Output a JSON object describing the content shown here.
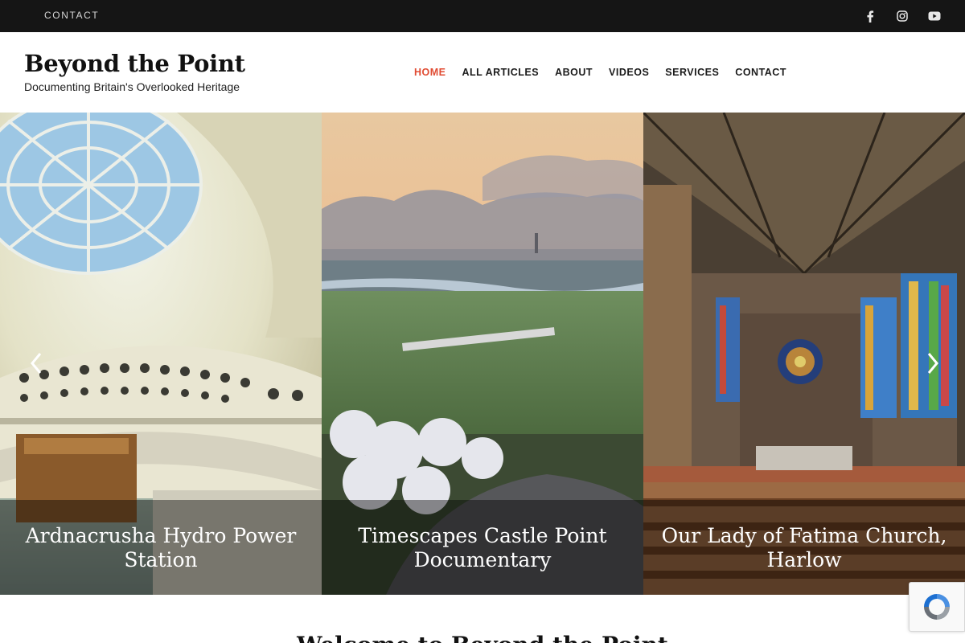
{
  "topbar": {
    "contact_label": "CONTACT",
    "socials": [
      "facebook-icon",
      "instagram-icon",
      "youtube-icon"
    ]
  },
  "header": {
    "title": "Beyond the Point",
    "tagline": "Documenting Britain's Overlooked Heritage"
  },
  "nav": {
    "items": [
      "HOME",
      "ALL ARTICLES",
      "ABOUT",
      "VIDEOS",
      "SERVICES",
      "CONTACT"
    ],
    "active": "HOME"
  },
  "hero": {
    "slides": [
      {
        "caption": "Ardnacrusha Hydro Power Station"
      },
      {
        "caption": "Timescapes Castle Point Documentary"
      },
      {
        "caption": "Our Lady of Fatima Church, Harlow"
      }
    ],
    "prev_icon": "chevron-left-icon",
    "next_icon": "chevron-right-icon"
  },
  "welcome": {
    "heading": "Welcome to Beyond the Point"
  },
  "colors": {
    "accent": "#e04b32",
    "topbar_bg": "#151515"
  }
}
